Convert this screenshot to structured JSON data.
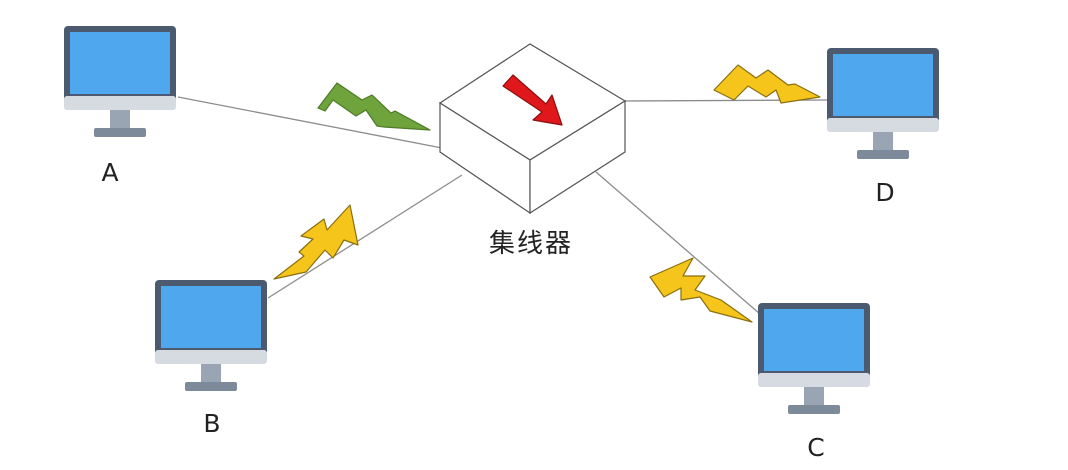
{
  "diagram": {
    "hub": {
      "label": "集线器"
    },
    "computers": [
      {
        "id": "A",
        "label": "A"
      },
      {
        "id": "B",
        "label": "B"
      },
      {
        "id": "C",
        "label": "C"
      },
      {
        "id": "D",
        "label": "D"
      }
    ],
    "connections": [
      {
        "from": "hub",
        "to": "A",
        "signal_color": "#6fa33b"
      },
      {
        "from": "hub",
        "to": "B",
        "signal_color": "#f5c51c"
      },
      {
        "from": "hub",
        "to": "C",
        "signal_color": "#f5c51c"
      },
      {
        "from": "hub",
        "to": "D",
        "signal_color": "#f5c51c"
      }
    ],
    "colors": {
      "screen": "#4fa8ee",
      "monitor_frame": "#4b5a6e",
      "monitor_chin": "#d6dbe1",
      "stand": "#9aa5b3",
      "base": "#7d8a99",
      "line": "#8c8c8c",
      "hub_fill": "#ffffff",
      "hub_stroke": "#555555",
      "arrow": "#e0181b",
      "bolt_outline": "#555555"
    }
  }
}
